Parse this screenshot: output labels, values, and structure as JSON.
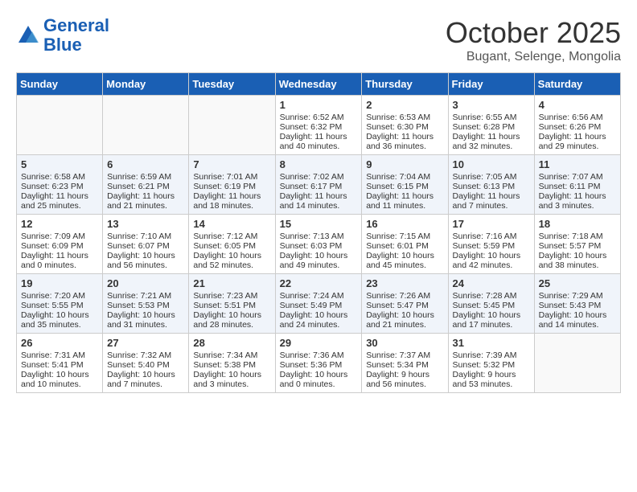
{
  "header": {
    "logo_line1": "General",
    "logo_line2": "Blue",
    "month": "October 2025",
    "location": "Bugant, Selenge, Mongolia"
  },
  "days_of_week": [
    "Sunday",
    "Monday",
    "Tuesday",
    "Wednesday",
    "Thursday",
    "Friday",
    "Saturday"
  ],
  "weeks": [
    [
      {
        "day": "",
        "info": ""
      },
      {
        "day": "",
        "info": ""
      },
      {
        "day": "",
        "info": ""
      },
      {
        "day": "1",
        "info": "Sunrise: 6:52 AM\nSunset: 6:32 PM\nDaylight: 11 hours and 40 minutes."
      },
      {
        "day": "2",
        "info": "Sunrise: 6:53 AM\nSunset: 6:30 PM\nDaylight: 11 hours and 36 minutes."
      },
      {
        "day": "3",
        "info": "Sunrise: 6:55 AM\nSunset: 6:28 PM\nDaylight: 11 hours and 32 minutes."
      },
      {
        "day": "4",
        "info": "Sunrise: 6:56 AM\nSunset: 6:26 PM\nDaylight: 11 hours and 29 minutes."
      }
    ],
    [
      {
        "day": "5",
        "info": "Sunrise: 6:58 AM\nSunset: 6:23 PM\nDaylight: 11 hours and 25 minutes."
      },
      {
        "day": "6",
        "info": "Sunrise: 6:59 AM\nSunset: 6:21 PM\nDaylight: 11 hours and 21 minutes."
      },
      {
        "day": "7",
        "info": "Sunrise: 7:01 AM\nSunset: 6:19 PM\nDaylight: 11 hours and 18 minutes."
      },
      {
        "day": "8",
        "info": "Sunrise: 7:02 AM\nSunset: 6:17 PM\nDaylight: 11 hours and 14 minutes."
      },
      {
        "day": "9",
        "info": "Sunrise: 7:04 AM\nSunset: 6:15 PM\nDaylight: 11 hours and 11 minutes."
      },
      {
        "day": "10",
        "info": "Sunrise: 7:05 AM\nSunset: 6:13 PM\nDaylight: 11 hours and 7 minutes."
      },
      {
        "day": "11",
        "info": "Sunrise: 7:07 AM\nSunset: 6:11 PM\nDaylight: 11 hours and 3 minutes."
      }
    ],
    [
      {
        "day": "12",
        "info": "Sunrise: 7:09 AM\nSunset: 6:09 PM\nDaylight: 11 hours and 0 minutes."
      },
      {
        "day": "13",
        "info": "Sunrise: 7:10 AM\nSunset: 6:07 PM\nDaylight: 10 hours and 56 minutes."
      },
      {
        "day": "14",
        "info": "Sunrise: 7:12 AM\nSunset: 6:05 PM\nDaylight: 10 hours and 52 minutes."
      },
      {
        "day": "15",
        "info": "Sunrise: 7:13 AM\nSunset: 6:03 PM\nDaylight: 10 hours and 49 minutes."
      },
      {
        "day": "16",
        "info": "Sunrise: 7:15 AM\nSunset: 6:01 PM\nDaylight: 10 hours and 45 minutes."
      },
      {
        "day": "17",
        "info": "Sunrise: 7:16 AM\nSunset: 5:59 PM\nDaylight: 10 hours and 42 minutes."
      },
      {
        "day": "18",
        "info": "Sunrise: 7:18 AM\nSunset: 5:57 PM\nDaylight: 10 hours and 38 minutes."
      }
    ],
    [
      {
        "day": "19",
        "info": "Sunrise: 7:20 AM\nSunset: 5:55 PM\nDaylight: 10 hours and 35 minutes."
      },
      {
        "day": "20",
        "info": "Sunrise: 7:21 AM\nSunset: 5:53 PM\nDaylight: 10 hours and 31 minutes."
      },
      {
        "day": "21",
        "info": "Sunrise: 7:23 AM\nSunset: 5:51 PM\nDaylight: 10 hours and 28 minutes."
      },
      {
        "day": "22",
        "info": "Sunrise: 7:24 AM\nSunset: 5:49 PM\nDaylight: 10 hours and 24 minutes."
      },
      {
        "day": "23",
        "info": "Sunrise: 7:26 AM\nSunset: 5:47 PM\nDaylight: 10 hours and 21 minutes."
      },
      {
        "day": "24",
        "info": "Sunrise: 7:28 AM\nSunset: 5:45 PM\nDaylight: 10 hours and 17 minutes."
      },
      {
        "day": "25",
        "info": "Sunrise: 7:29 AM\nSunset: 5:43 PM\nDaylight: 10 hours and 14 minutes."
      }
    ],
    [
      {
        "day": "26",
        "info": "Sunrise: 7:31 AM\nSunset: 5:41 PM\nDaylight: 10 hours and 10 minutes."
      },
      {
        "day": "27",
        "info": "Sunrise: 7:32 AM\nSunset: 5:40 PM\nDaylight: 10 hours and 7 minutes."
      },
      {
        "day": "28",
        "info": "Sunrise: 7:34 AM\nSunset: 5:38 PM\nDaylight: 10 hours and 3 minutes."
      },
      {
        "day": "29",
        "info": "Sunrise: 7:36 AM\nSunset: 5:36 PM\nDaylight: 10 hours and 0 minutes."
      },
      {
        "day": "30",
        "info": "Sunrise: 7:37 AM\nSunset: 5:34 PM\nDaylight: 9 hours and 56 minutes."
      },
      {
        "day": "31",
        "info": "Sunrise: 7:39 AM\nSunset: 5:32 PM\nDaylight: 9 hours and 53 minutes."
      },
      {
        "day": "",
        "info": ""
      }
    ]
  ]
}
